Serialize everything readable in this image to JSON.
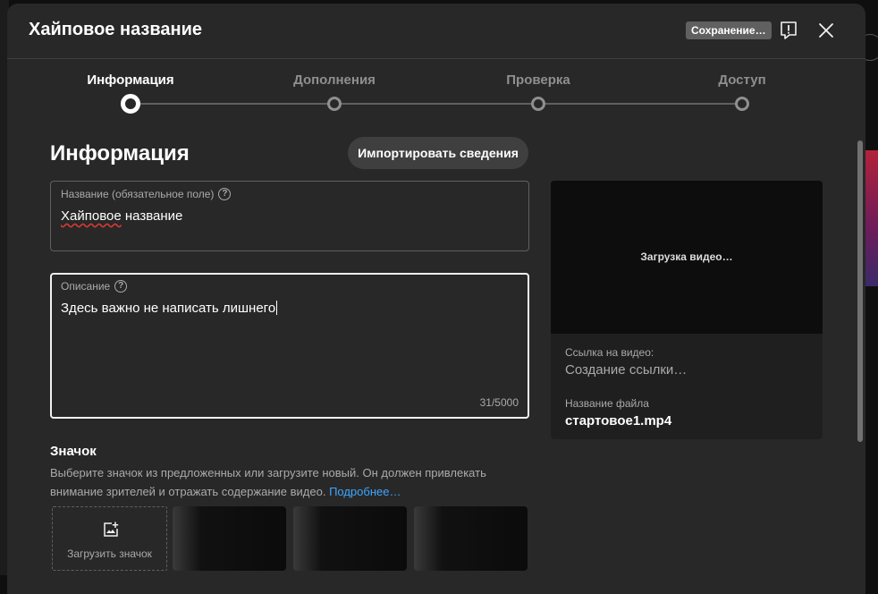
{
  "dialog": {
    "title": "Хайповое название",
    "saving_badge": "Сохранение…"
  },
  "stepper": {
    "steps": [
      {
        "label": "Информация",
        "active": true
      },
      {
        "label": "Дополнения",
        "active": false
      },
      {
        "label": "Проверка",
        "active": false
      },
      {
        "label": "Доступ",
        "active": false
      }
    ]
  },
  "details": {
    "section_title": "Информация",
    "import_button": "Импортировать сведения",
    "title_field": {
      "label": "Название (обязательное поле)",
      "value_word1": "Хайповое",
      "value_rest": " название"
    },
    "description_field": {
      "label": "Описание",
      "value": "Здесь важно не написать лишнего",
      "counter": "31/5000"
    },
    "thumbnail": {
      "title": "Значок",
      "description": "Выберите значок из предложенных или загрузите новый. Он должен привлекать внимание зрителей и отражать содержание видео.",
      "learn_more": "Подробнее…",
      "upload_label": "Загрузить значок"
    }
  },
  "preview": {
    "loading_text": "Загрузка видео…",
    "link_label": "Ссылка на видео:",
    "link_value": "Создание ссылки…",
    "filename_label": "Название файла",
    "filename_value": "стартовое1.mp4"
  },
  "colors": {
    "dialog_bg": "#282828",
    "link": "#3ea6ff",
    "badge_bg": "#606060"
  }
}
